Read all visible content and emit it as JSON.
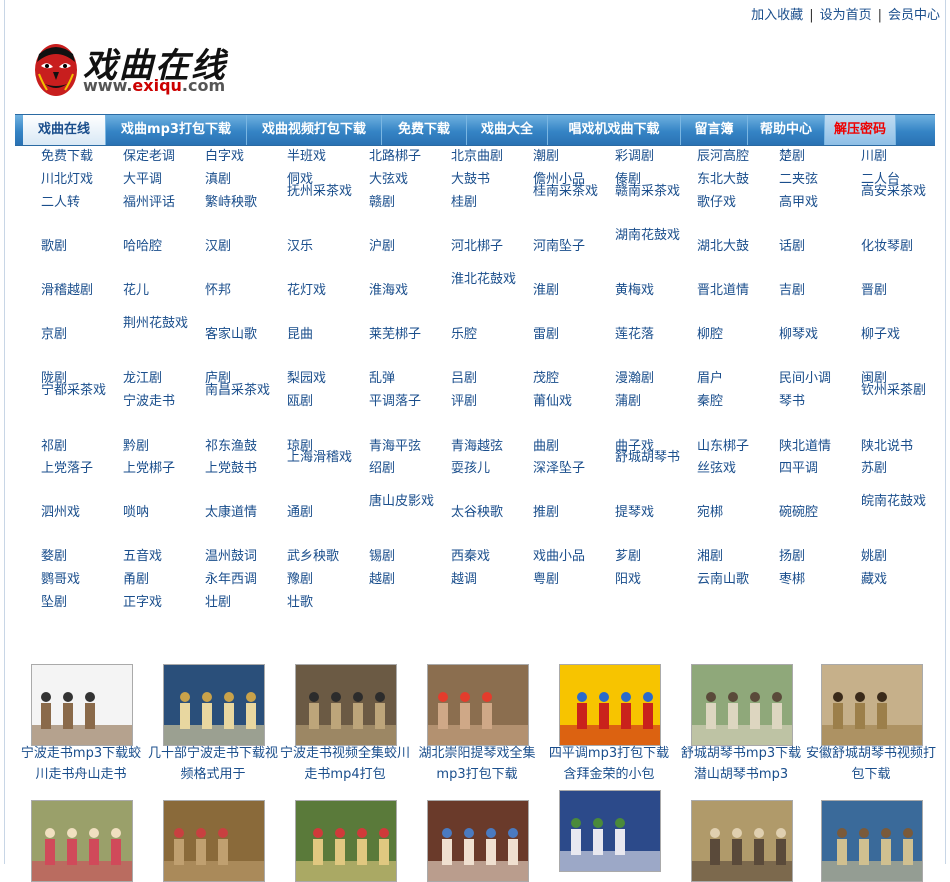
{
  "toplinks": {
    "add_favorite": "加入收藏",
    "set_home": "设为首页",
    "member_center": "会员中心",
    "separator": "|"
  },
  "logo": {
    "title": "戏曲在线",
    "domain_prefix": "www.",
    "domain_main": "exiqu",
    "domain_suffix": ".com"
  },
  "nav": {
    "items": [
      "戏曲在线",
      "戏曲mp3打包下载",
      "戏曲视频打包下载",
      "免费下载",
      "戏曲大全",
      "唱戏机戏曲下载",
      "留言簿",
      "帮助中心",
      "解压密码"
    ]
  },
  "opera_types": [
    [
      "免费下载",
      "保定老调",
      "白字戏",
      "半班戏",
      "北路梆子",
      "北京曲剧",
      "潮剧",
      "彩调剧",
      "辰河高腔",
      "楚剧",
      "川剧"
    ],
    [
      "川北灯戏",
      "大平调",
      "滇剧",
      "侗戏",
      "大弦戏",
      "大鼓书",
      "儋州小品",
      "傣剧",
      "东北大鼓",
      "二夹弦",
      "二人台"
    ],
    [
      "二人转",
      "福州评话",
      "繁峙秧歌",
      "抚州采茶戏",
      "赣剧",
      "桂剧",
      "桂南采茶戏",
      "赣南采茶戏",
      "歌仔戏",
      "高甲戏",
      "高安采茶戏"
    ],
    [
      "歌剧",
      "哈哈腔",
      "汉剧",
      "汉乐",
      "沪剧",
      "河北梆子",
      "河南坠子",
      "湖南花鼓戏",
      "湖北大鼓",
      "话剧",
      "化妆琴剧"
    ],
    [
      "滑稽越剧",
      "花儿",
      "怀邦",
      "花灯戏",
      "淮海戏",
      "淮北花鼓戏",
      "淮剧",
      "黄梅戏",
      "晋北道情",
      "吉剧",
      "晋剧"
    ],
    [
      "京剧",
      "荆州花鼓戏",
      "客家山歌",
      "昆曲",
      "莱芜梆子",
      "乐腔",
      "雷剧",
      "莲花落",
      "柳腔",
      "柳琴戏",
      "柳子戏"
    ],
    [
      "陇剧",
      "龙江剧",
      "庐剧",
      "梨园戏",
      "乱弹",
      "吕剧",
      "茂腔",
      "漫瀚剧",
      "眉户",
      "民间小调",
      "闽剧"
    ],
    [
      "宁都采茶戏",
      "宁波走书",
      "南昌采茶戏",
      "瓯剧",
      "平调落子",
      "评剧",
      "莆仙戏",
      "蒲剧",
      "秦腔",
      "琴书",
      "钦州采茶剧"
    ],
    [
      "祁剧",
      "黔剧",
      "祁东渔鼓",
      "琼剧",
      "青海平弦",
      "青海越弦",
      "曲剧",
      "曲子戏",
      "山东梆子",
      "陕北道情",
      "陕北说书"
    ],
    [
      "上党落子",
      "上党梆子",
      "上党鼓书",
      "上海滑稽戏",
      "绍剧",
      "耍孩儿",
      "深泽坠子",
      "舒城胡琴书",
      "丝弦戏",
      "四平调",
      "苏剧"
    ],
    [
      "泗州戏",
      "唢呐",
      "太康道情",
      "通剧",
      "唐山皮影戏",
      "太谷秧歌",
      "推剧",
      "提琴戏",
      "宛梆",
      "碗碗腔",
      "皖南花鼓戏"
    ],
    [
      "婺剧",
      "五音戏",
      "温州鼓词",
      "武乡秧歌",
      "锡剧",
      "西秦戏",
      "戏曲小品",
      "芗剧",
      "湘剧",
      "扬剧",
      "姚剧"
    ],
    [
      "鹦哥戏",
      "甬剧",
      "永年西调",
      "豫剧",
      "越剧",
      "越调",
      "粤剧",
      "阳戏",
      "云南山歌",
      "枣梆",
      "藏戏"
    ],
    [
      "坠剧",
      "正字戏",
      "壮剧",
      "壮歌"
    ]
  ],
  "videos_row1": [
    {
      "caption": "宁波走书mp3下载蛟川走书舟山走书"
    },
    {
      "caption": "几十部宁波走书下载视频格式用于"
    },
    {
      "caption": "宁波走书视频全集蛟川走书mp4打包"
    },
    {
      "caption": "湖北崇阳提琴戏全集mp3打包下载"
    },
    {
      "caption": "四平调mp3打包下载含拜金荣的小包"
    },
    {
      "caption": "舒城胡琴书mp3下载潜山胡琴书mp3"
    },
    {
      "caption": "安徽舒城胡琴书视频打包下载"
    }
  ],
  "videos_row2": [
    {
      "caption": ""
    },
    {
      "caption": ""
    },
    {
      "caption": ""
    },
    {
      "caption": ""
    },
    {
      "caption": ""
    },
    {
      "caption": ""
    },
    {
      "caption": ""
    }
  ],
  "colors": {
    "link": "#1a4e8c",
    "nav_blue": "#3584c5",
    "nav_red_text": "#e00000"
  }
}
